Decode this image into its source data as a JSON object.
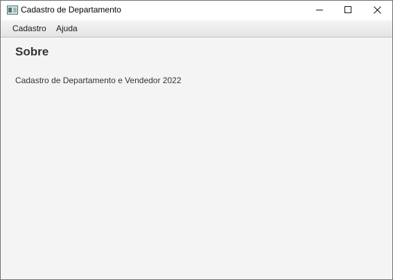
{
  "window": {
    "title": "Cadastro de Departamento",
    "controls": {
      "minimize": "minimize-icon",
      "maximize": "maximize-icon",
      "close": "close-icon"
    }
  },
  "menubar": {
    "items": [
      {
        "label": "Cadastro"
      },
      {
        "label": "Ajuda"
      }
    ]
  },
  "content": {
    "title": "Sobre",
    "text": "Cadastro de Departamento e Vendedor 2022"
  }
}
